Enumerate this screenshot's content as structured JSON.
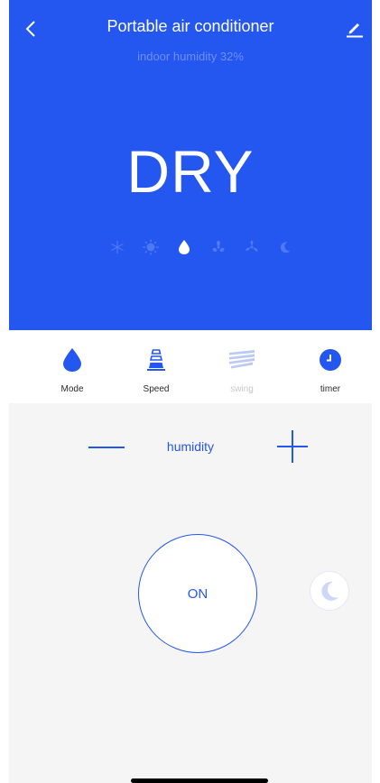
{
  "header": {
    "title": "Portable air conditioner",
    "subtitle": "indoor humidity 32%",
    "current_mode": "DRY",
    "mode_icons": [
      "snowflake-icon",
      "sun-icon",
      "water-drop-icon",
      "fan-icon",
      "fan-blades-icon",
      "moon-icon"
    ],
    "active_mode_icon": "water-drop-icon",
    "background_color": "#2456f0"
  },
  "tabs": [
    {
      "label": "Mode",
      "icon": "water-drop-icon",
      "enabled": true
    },
    {
      "label": "Speed",
      "icon": "speed-cone-icon",
      "enabled": true
    },
    {
      "label": "swing",
      "icon": "swing-icon",
      "enabled": false
    },
    {
      "label": "timer",
      "icon": "clock-icon",
      "enabled": true
    }
  ],
  "control": {
    "setting_label": "humidity",
    "power_label": "ON",
    "accent_color": "#2456f0"
  }
}
